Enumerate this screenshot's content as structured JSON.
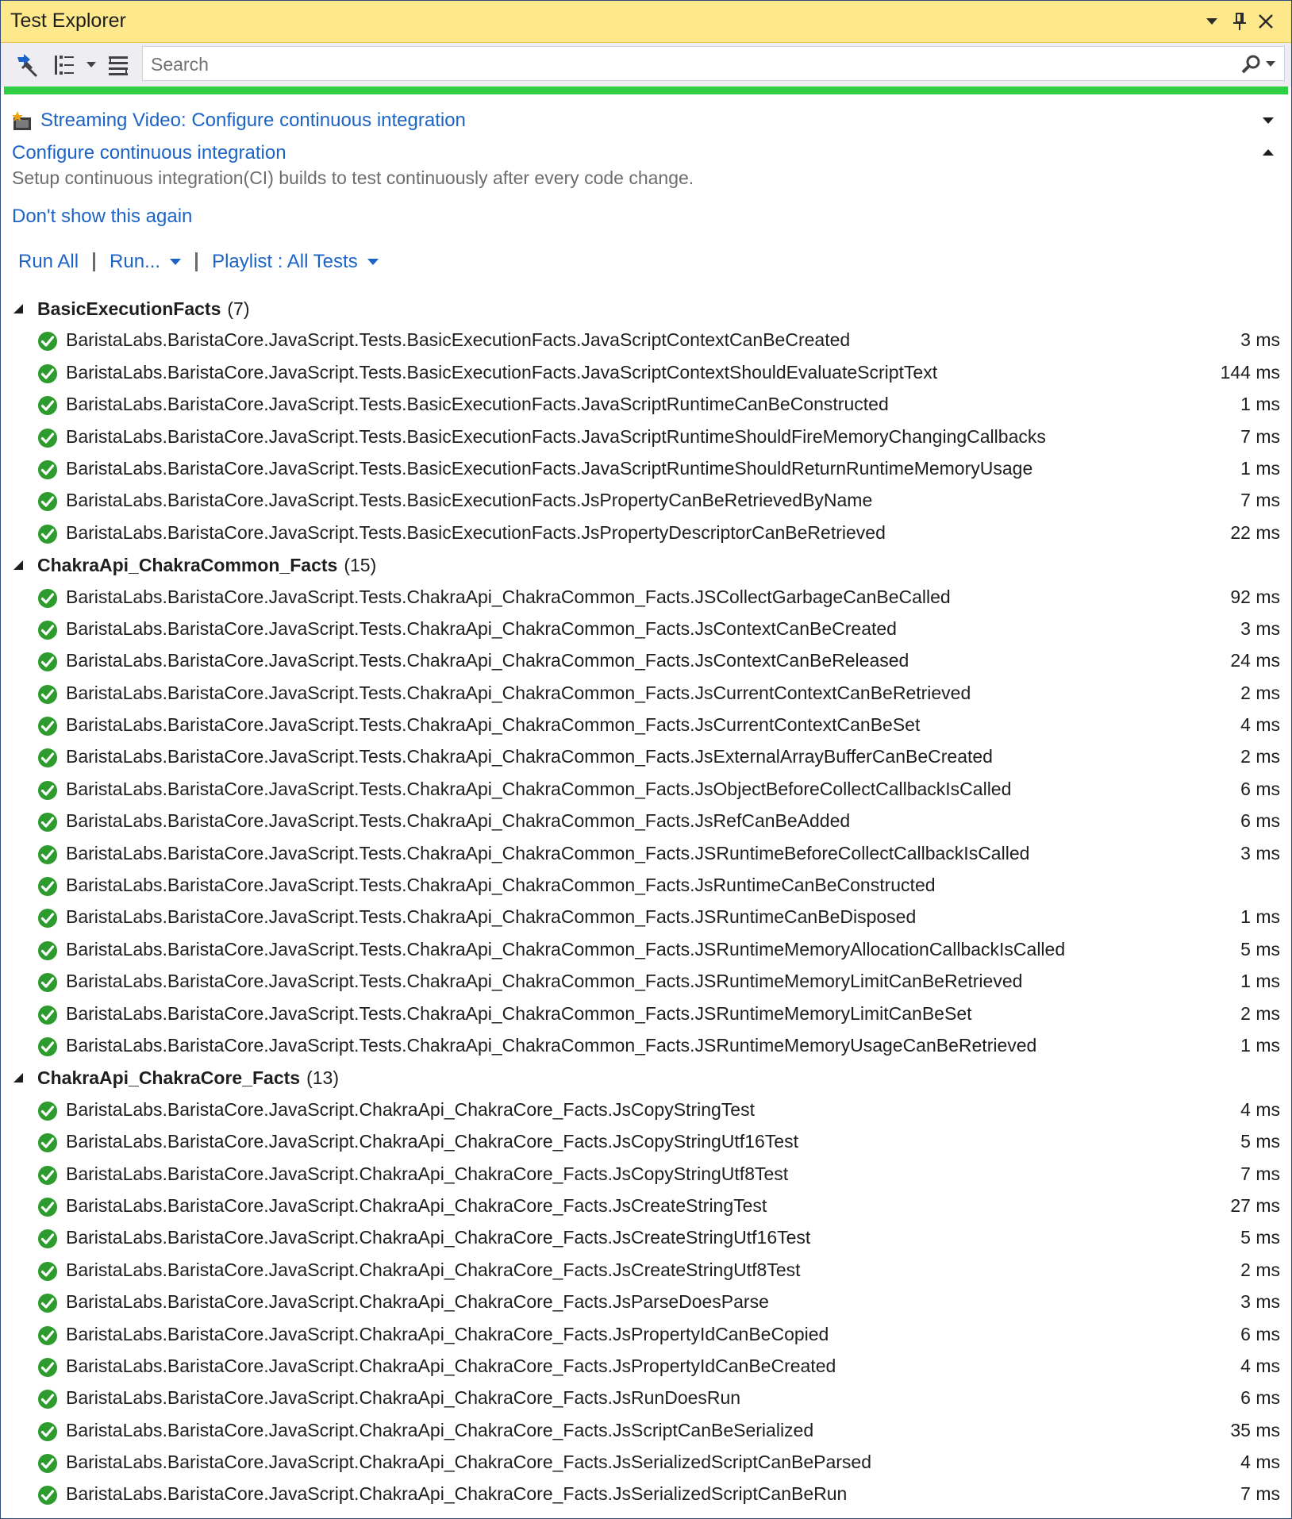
{
  "window": {
    "title": "Test Explorer",
    "buttons": {
      "dropdown": "▼",
      "pin": "pin",
      "close": "✕"
    }
  },
  "toolbar": {
    "search": {
      "placeholder": "Search",
      "value": ""
    }
  },
  "progress": {
    "fraction": 1.0,
    "color": "#2fcf45"
  },
  "notification": {
    "video_link": "Streaming Video: Configure continuous integration",
    "ci_title": "Configure continuous integration",
    "ci_description": "Setup continuous integration(CI) builds to test continuously after every code change.",
    "dont_show": "Don't show this again"
  },
  "runbar": {
    "run_all": "Run All",
    "run": "Run...",
    "playlist": "Playlist : All Tests"
  },
  "groups": [
    {
      "name": "BasicExecutionFacts",
      "count": "(7)",
      "tests": [
        {
          "name": "BaristaLabs.BaristaCore.JavaScript.Tests.BasicExecutionFacts.JavaScriptContextCanBeCreated",
          "time": "3 ms"
        },
        {
          "name": "BaristaLabs.BaristaCore.JavaScript.Tests.BasicExecutionFacts.JavaScriptContextShouldEvaluateScriptText",
          "time": "144 ms"
        },
        {
          "name": "BaristaLabs.BaristaCore.JavaScript.Tests.BasicExecutionFacts.JavaScriptRuntimeCanBeConstructed",
          "time": "1 ms"
        },
        {
          "name": "BaristaLabs.BaristaCore.JavaScript.Tests.BasicExecutionFacts.JavaScriptRuntimeShouldFireMemoryChangingCallbacks",
          "time": "7 ms"
        },
        {
          "name": "BaristaLabs.BaristaCore.JavaScript.Tests.BasicExecutionFacts.JavaScriptRuntimeShouldReturnRuntimeMemoryUsage",
          "time": "1 ms"
        },
        {
          "name": "BaristaLabs.BaristaCore.JavaScript.Tests.BasicExecutionFacts.JsPropertyCanBeRetrievedByName",
          "time": "7 ms"
        },
        {
          "name": "BaristaLabs.BaristaCore.JavaScript.Tests.BasicExecutionFacts.JsPropertyDescriptorCanBeRetrieved",
          "time": "22 ms"
        }
      ]
    },
    {
      "name": "ChakraApi_ChakraCommon_Facts",
      "count": "(15)",
      "tests": [
        {
          "name": "BaristaLabs.BaristaCore.JavaScript.Tests.ChakraApi_ChakraCommon_Facts.JSCollectGarbageCanBeCalled",
          "time": "92 ms"
        },
        {
          "name": "BaristaLabs.BaristaCore.JavaScript.Tests.ChakraApi_ChakraCommon_Facts.JsContextCanBeCreated",
          "time": "3 ms"
        },
        {
          "name": "BaristaLabs.BaristaCore.JavaScript.Tests.ChakraApi_ChakraCommon_Facts.JsContextCanBeReleased",
          "time": "24 ms"
        },
        {
          "name": "BaristaLabs.BaristaCore.JavaScript.Tests.ChakraApi_ChakraCommon_Facts.JsCurrentContextCanBeRetrieved",
          "time": "2 ms"
        },
        {
          "name": "BaristaLabs.BaristaCore.JavaScript.Tests.ChakraApi_ChakraCommon_Facts.JsCurrentContextCanBeSet",
          "time": "4 ms"
        },
        {
          "name": "BaristaLabs.BaristaCore.JavaScript.Tests.ChakraApi_ChakraCommon_Facts.JsExternalArrayBufferCanBeCreated",
          "time": "2 ms"
        },
        {
          "name": "BaristaLabs.BaristaCore.JavaScript.Tests.ChakraApi_ChakraCommon_Facts.JsObjectBeforeCollectCallbackIsCalled",
          "time": "6 ms"
        },
        {
          "name": "BaristaLabs.BaristaCore.JavaScript.Tests.ChakraApi_ChakraCommon_Facts.JsRefCanBeAdded",
          "time": "6 ms"
        },
        {
          "name": "BaristaLabs.BaristaCore.JavaScript.Tests.ChakraApi_ChakraCommon_Facts.JSRuntimeBeforeCollectCallbackIsCalled",
          "time": "3 ms"
        },
        {
          "name": "BaristaLabs.BaristaCore.JavaScript.Tests.ChakraApi_ChakraCommon_Facts.JsRuntimeCanBeConstructed",
          "time": ""
        },
        {
          "name": "BaristaLabs.BaristaCore.JavaScript.Tests.ChakraApi_ChakraCommon_Facts.JSRuntimeCanBeDisposed",
          "time": "1 ms"
        },
        {
          "name": "BaristaLabs.BaristaCore.JavaScript.Tests.ChakraApi_ChakraCommon_Facts.JSRuntimeMemoryAllocationCallbackIsCalled",
          "time": "5 ms"
        },
        {
          "name": "BaristaLabs.BaristaCore.JavaScript.Tests.ChakraApi_ChakraCommon_Facts.JSRuntimeMemoryLimitCanBeRetrieved",
          "time": "1 ms"
        },
        {
          "name": "BaristaLabs.BaristaCore.JavaScript.Tests.ChakraApi_ChakraCommon_Facts.JSRuntimeMemoryLimitCanBeSet",
          "time": "2 ms"
        },
        {
          "name": "BaristaLabs.BaristaCore.JavaScript.Tests.ChakraApi_ChakraCommon_Facts.JSRuntimeMemoryUsageCanBeRetrieved",
          "time": "1 ms"
        }
      ]
    },
    {
      "name": "ChakraApi_ChakraCore_Facts",
      "count": "(13)",
      "tests": [
        {
          "name": "BaristaLabs.BaristaCore.JavaScript.ChakraApi_ChakraCore_Facts.JsCopyStringTest",
          "time": "4 ms"
        },
        {
          "name": "BaristaLabs.BaristaCore.JavaScript.ChakraApi_ChakraCore_Facts.JsCopyStringUtf16Test",
          "time": "5 ms"
        },
        {
          "name": "BaristaLabs.BaristaCore.JavaScript.ChakraApi_ChakraCore_Facts.JsCopyStringUtf8Test",
          "time": "7 ms"
        },
        {
          "name": "BaristaLabs.BaristaCore.JavaScript.ChakraApi_ChakraCore_Facts.JsCreateStringTest",
          "time": "27 ms"
        },
        {
          "name": "BaristaLabs.BaristaCore.JavaScript.ChakraApi_ChakraCore_Facts.JsCreateStringUtf16Test",
          "time": "5 ms"
        },
        {
          "name": "BaristaLabs.BaristaCore.JavaScript.ChakraApi_ChakraCore_Facts.JsCreateStringUtf8Test",
          "time": "2 ms"
        },
        {
          "name": "BaristaLabs.BaristaCore.JavaScript.ChakraApi_ChakraCore_Facts.JsParseDoesParse",
          "time": "3 ms"
        },
        {
          "name": "BaristaLabs.BaristaCore.JavaScript.ChakraApi_ChakraCore_Facts.JsPropertyIdCanBeCopied",
          "time": "6 ms"
        },
        {
          "name": "BaristaLabs.BaristaCore.JavaScript.ChakraApi_ChakraCore_Facts.JsPropertyIdCanBeCreated",
          "time": "4 ms"
        },
        {
          "name": "BaristaLabs.BaristaCore.JavaScript.ChakraApi_ChakraCore_Facts.JsRunDoesRun",
          "time": "6 ms"
        },
        {
          "name": "BaristaLabs.BaristaCore.JavaScript.ChakraApi_ChakraCore_Facts.JsScriptCanBeSerialized",
          "time": "35 ms"
        },
        {
          "name": "BaristaLabs.BaristaCore.JavaScript.ChakraApi_ChakraCore_Facts.JsSerializedScriptCanBeParsed",
          "time": "4 ms"
        },
        {
          "name": "BaristaLabs.BaristaCore.JavaScript.ChakraApi_ChakraCore_Facts.JsSerializedScriptCanBeRun",
          "time": "7 ms"
        }
      ]
    }
  ]
}
